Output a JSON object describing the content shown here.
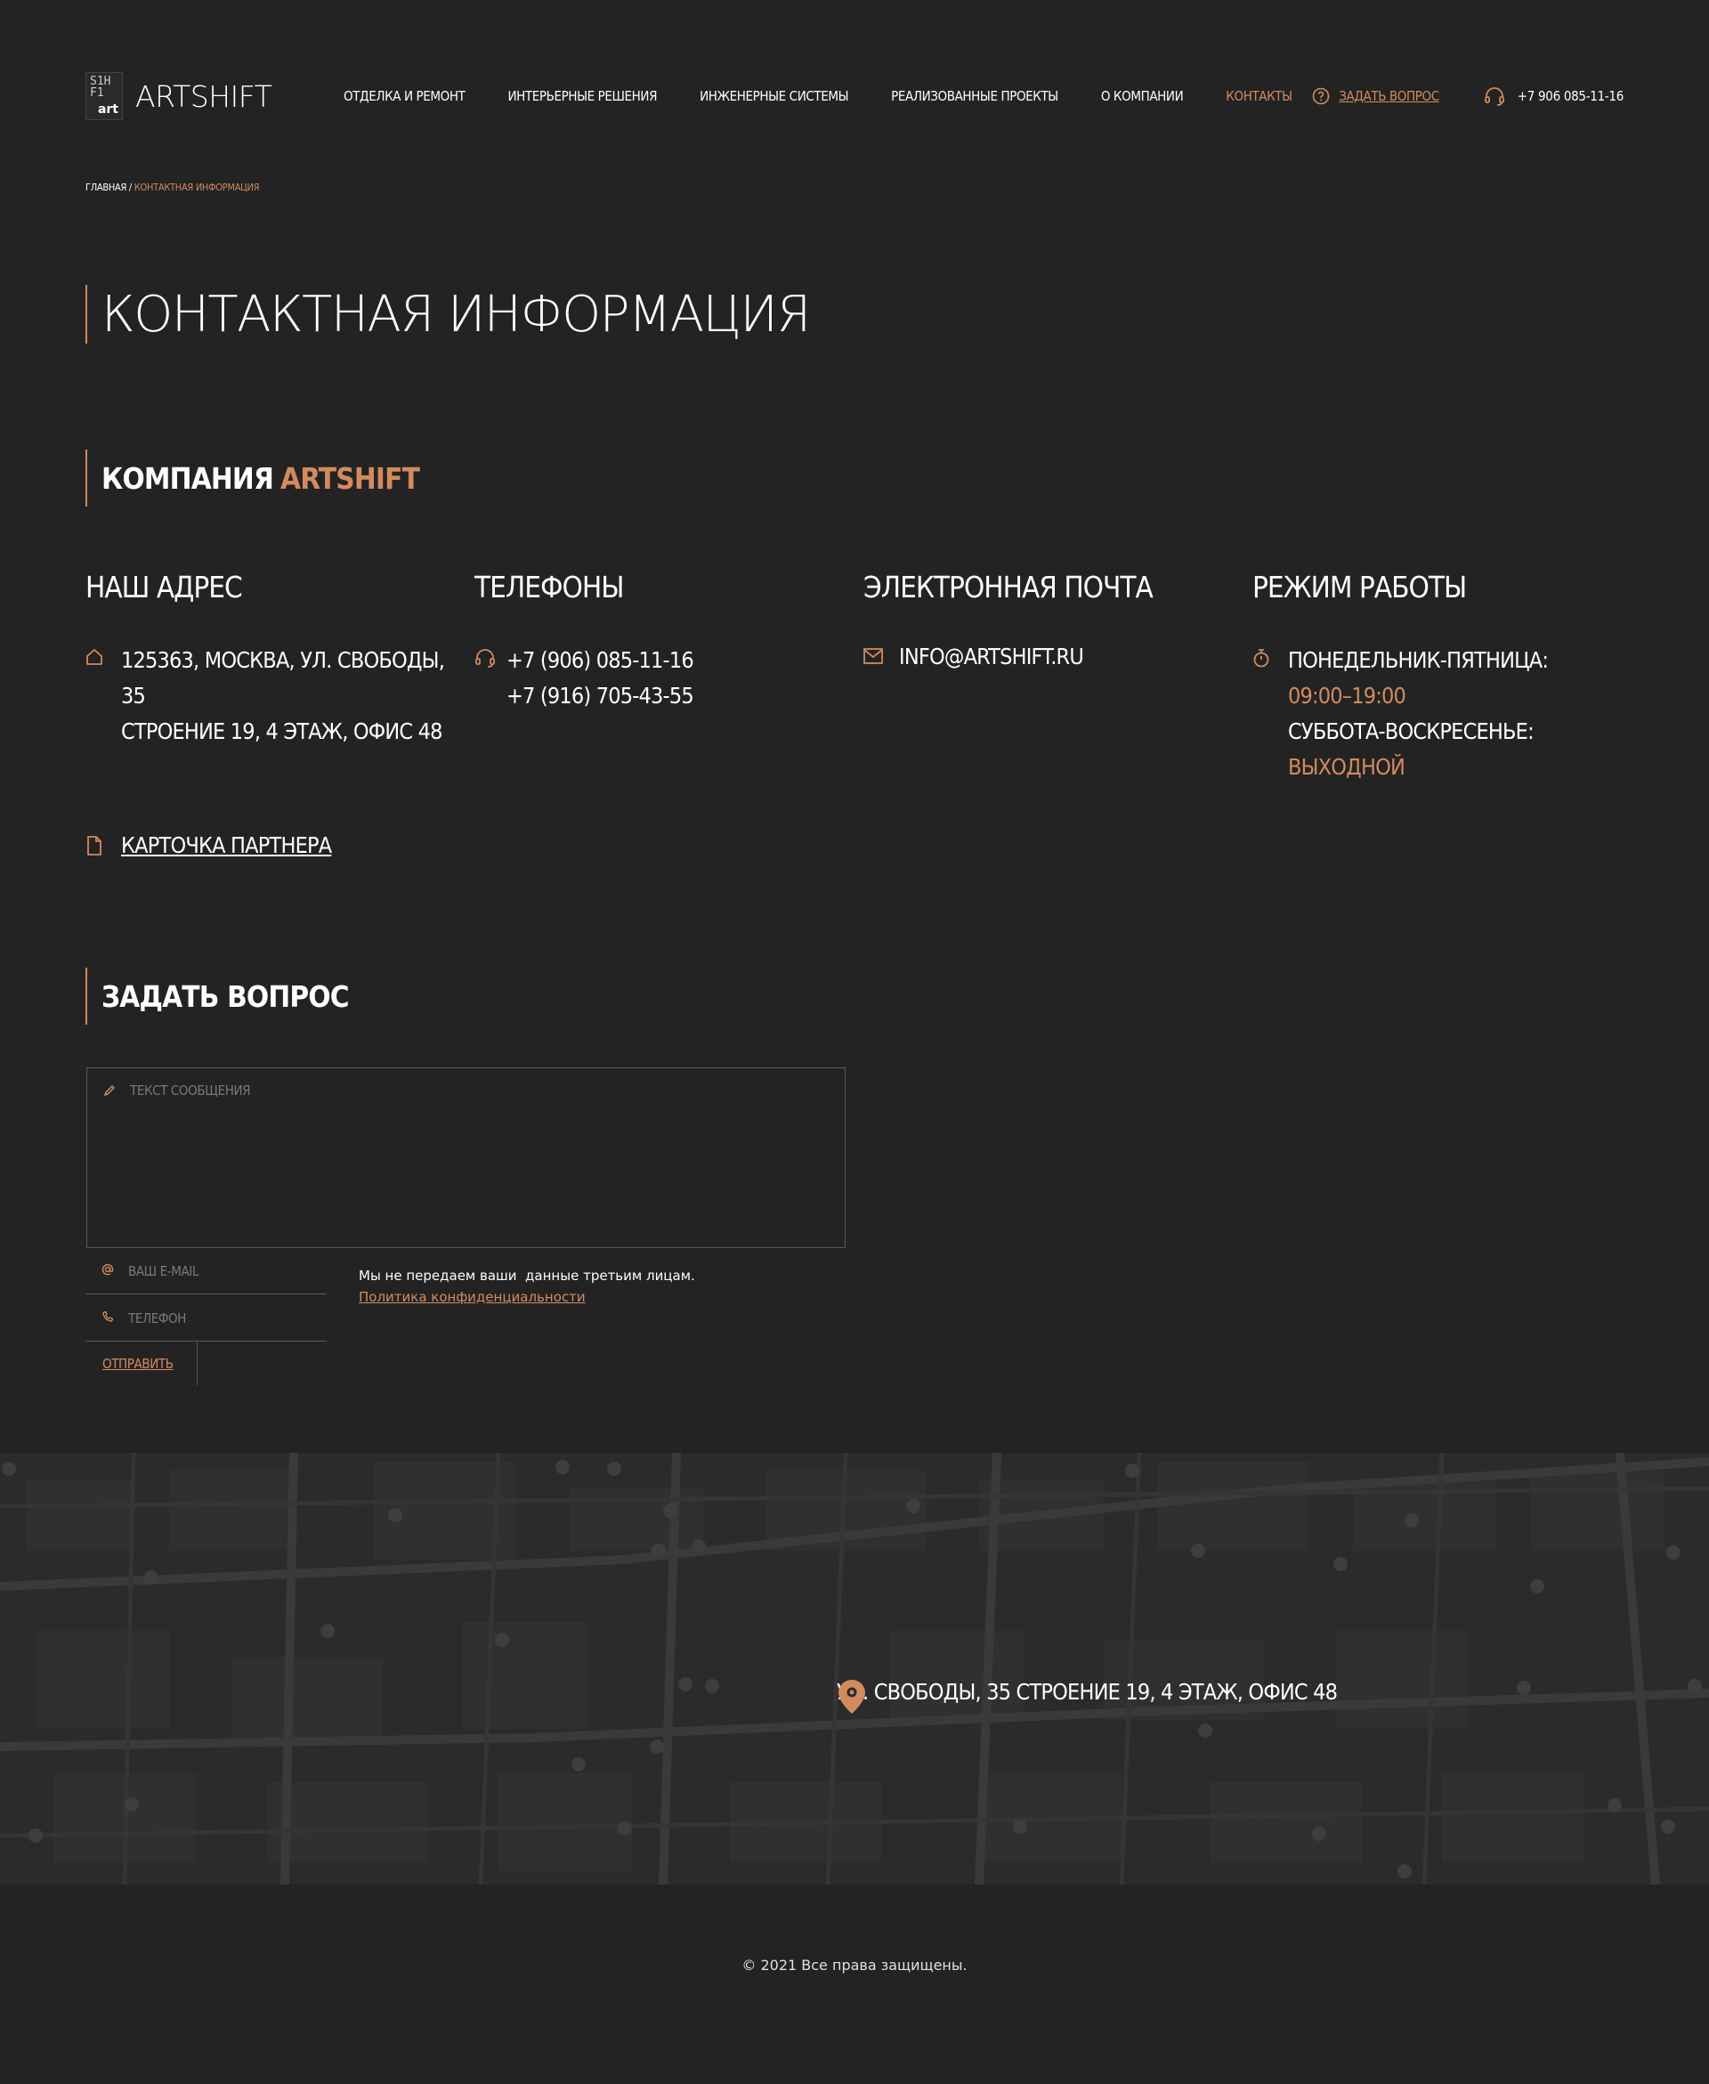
{
  "header": {
    "logo_mark": "S1H\nF1",
    "logo_mark_art": "art",
    "logo_text": "ARTSHIFT",
    "nav": [
      {
        "label": "ОТДЕЛКА И РЕМОНТ"
      },
      {
        "label": "ИНТЕРЬЕРНЫЕ РЕШЕНИЯ"
      },
      {
        "label": "ИНЖЕНЕРНЫЕ СИСТЕМЫ"
      },
      {
        "label": "РЕАЛИЗОВАННЫЕ ПРОЕКТЫ"
      },
      {
        "label": "О КОМПАНИИ"
      },
      {
        "label": "КОНТАКТЫ"
      }
    ],
    "ask_label": "ЗАДАТЬ ВОПРОС",
    "phone": "+7 906 085-11-16"
  },
  "breadcrumb": {
    "home": "ГЛАВНАЯ",
    "separator": " / ",
    "current": "КОНТАКТНАЯ ИНФОРМАЦИЯ"
  },
  "page_title": "КОНТАКТНАЯ ИНФОРМАЦИЯ",
  "company": {
    "title": "КОМПАНИЯ",
    "title_accent": "ARTSHIFT"
  },
  "columns": {
    "address": {
      "title": "НАШ АДРЕС",
      "line1": "125363, МОСКВА, УЛ. СВОБОДЫ, 35",
      "line2": "СТРОЕНИЕ 19, 4 ЭТАЖ, ОФИС 48"
    },
    "phones": {
      "title": "ТЕЛЕФОНЫ",
      "phone1": "+7 (906) 085-11-16",
      "phone2": "+7 (916) 705-43-55"
    },
    "email": {
      "title": "ЭЛЕКТРОННАЯ ПОЧТА",
      "value": "INFO@ARTSHIFT.RU"
    },
    "hours": {
      "title": "РЕЖИМ РАБОТЫ",
      "weekdays_label": "ПОНЕДЕЛЬНИК-ПЯТНИЦА:",
      "weekdays_value": "09:00–19:00",
      "weekend_label": "СУББОТА-ВОСКРЕСЕНЬЕ:",
      "weekend_value": "ВЫХОДНОЙ"
    }
  },
  "partner_card": "КАРТОЧКА ПАРТНЕРА",
  "form": {
    "title": "ЗАДАТЬ ВОПРОС",
    "message_placeholder": "ТЕКСТ СООБЩЕНИЯ",
    "email_placeholder": "ВАШ E-MAIL",
    "phone_placeholder": "ТЕЛЕФОН",
    "submit_label": "ОТПРАВИТЬ",
    "privacy_text": "Мы не передаем ваши  данные третьим лицам.",
    "privacy_link": "Политика конфиденциальности"
  },
  "map": {
    "address_label": "УЛ. СВОБОДЫ, 35 СТРОЕНИЕ 19, 4 ЭТАЖ, ОФИС 48"
  },
  "footer": {
    "copyright": "© 2021 Все права защищены."
  },
  "colors": {
    "accent": "#d18b5e",
    "background": "#232323",
    "text": "#ffffff"
  }
}
